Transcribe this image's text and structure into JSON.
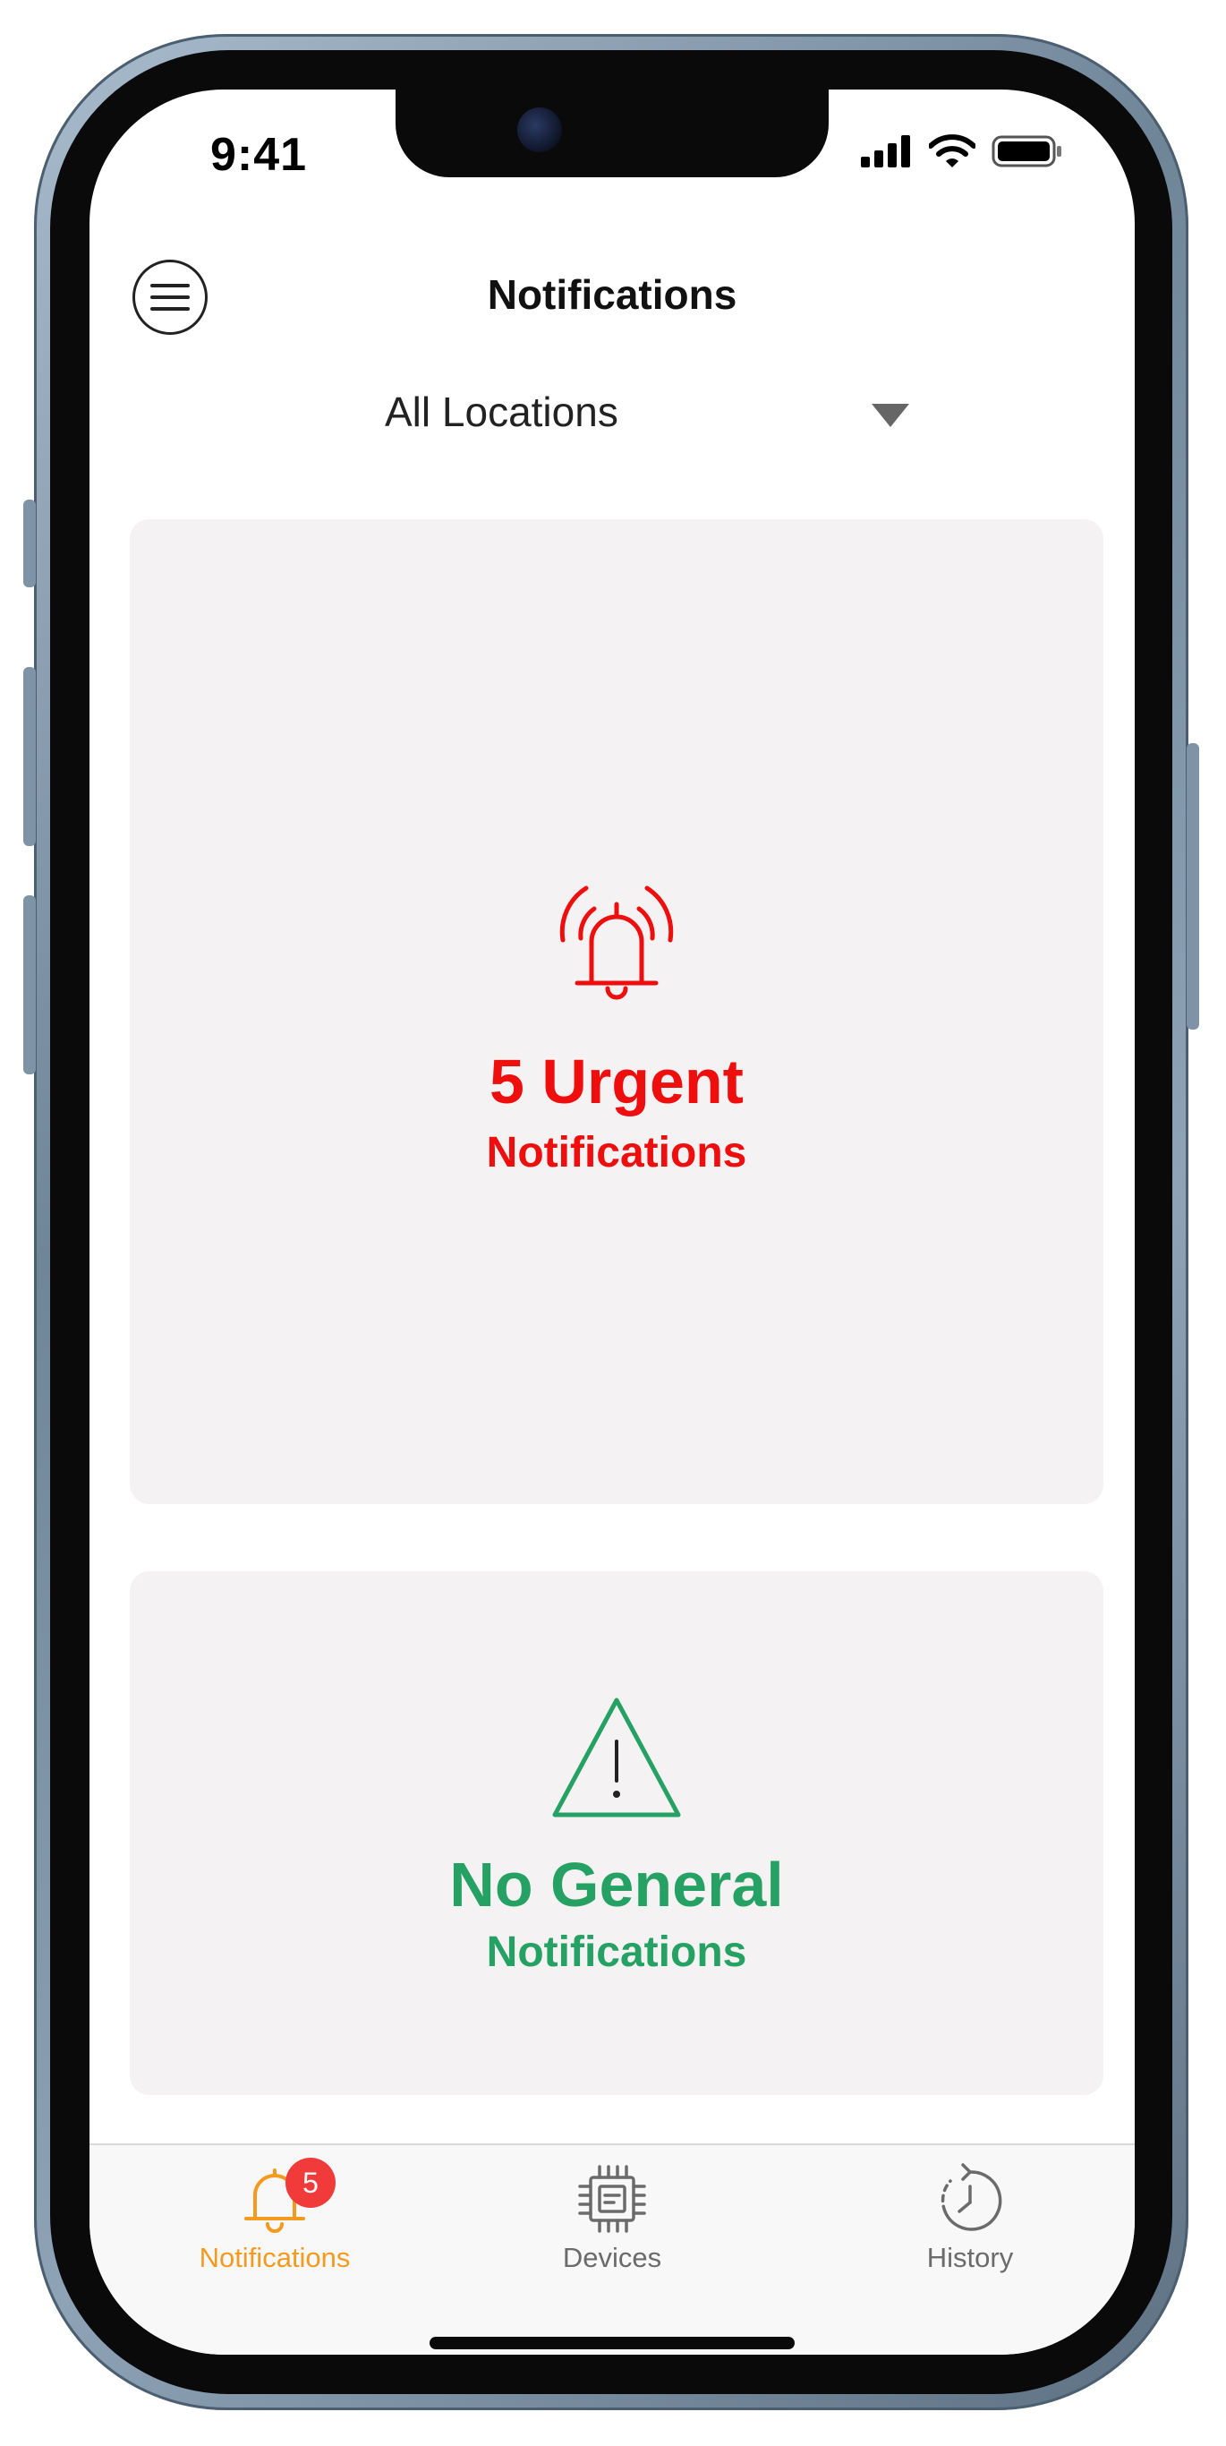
{
  "status_bar": {
    "time": "9:41"
  },
  "header": {
    "title": "Notifications"
  },
  "location_filter": {
    "selected": "All Locations"
  },
  "urgent_card": {
    "line1": "5 Urgent",
    "line2": "Notifications",
    "color": "#ee0e0e"
  },
  "general_card": {
    "line1": "No General",
    "line2": "Notifications",
    "color": "#26a164"
  },
  "tabbar": {
    "tabs": [
      {
        "label": "Notifications",
        "badge": "5",
        "active": true,
        "color": "#f39a1f"
      },
      {
        "label": "Devices",
        "active": false,
        "color": "#6b6b6b"
      },
      {
        "label": "History",
        "active": false,
        "color": "#6b6b6b"
      }
    ]
  }
}
